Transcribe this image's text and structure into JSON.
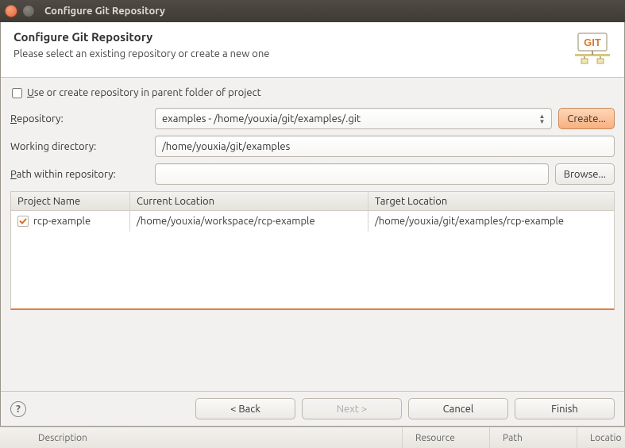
{
  "titlebar": {
    "title": "Configure Git Repository"
  },
  "header": {
    "title": "Configure Git Repository",
    "subtitle": "Please select an existing repository or create a new one"
  },
  "form": {
    "parent_folder_label_pre": "U",
    "parent_folder_label_rest": "se or create repository in parent folder of project",
    "repository_label_pre": "R",
    "repository_label_rest": "epository:",
    "repository_value": "examples - /home/youxia/git/examples/.git",
    "create_label": "Create...",
    "working_dir_label": "Working directory:",
    "working_dir_value": "/home/youxia/git/examples",
    "path_label_pre": "P",
    "path_label_rest": "ath within repository:",
    "path_value": "",
    "browse_label": "Browse..."
  },
  "table": {
    "headers": {
      "project": "Project Name",
      "current": "Current Location",
      "target": "Target Location"
    },
    "rows": [
      {
        "checked": true,
        "project": "rcp-example",
        "current": "/home/youxia/workspace/rcp-example",
        "target": "/home/youxia/git/examples/rcp-example"
      }
    ]
  },
  "footer": {
    "back": "< Back",
    "next": "Next >",
    "cancel": "Cancel",
    "finish": "Finish"
  },
  "behind": {
    "description": "Description",
    "resource": "Resource",
    "path": "Path",
    "location": "Locatio"
  }
}
